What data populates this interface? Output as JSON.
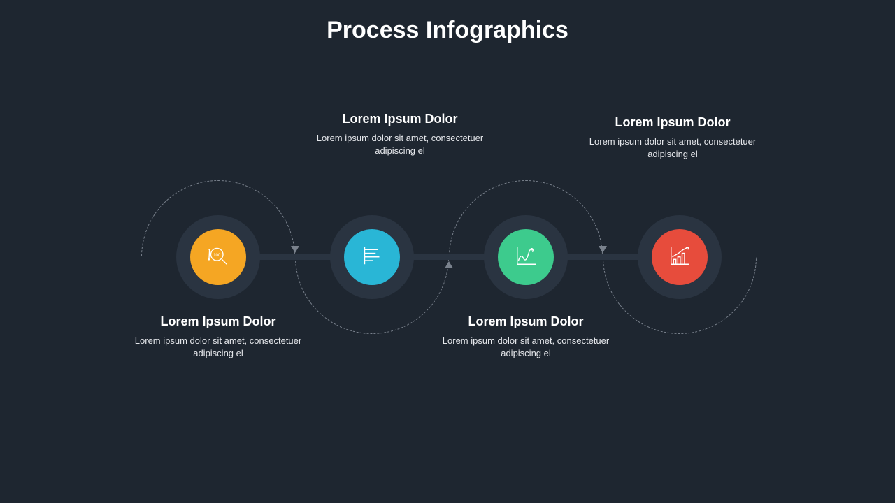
{
  "title": "Process Infographics",
  "steps": [
    {
      "heading": "Lorem Ipsum Dolor",
      "body": "Lorem ipsum dolor sit amet, consectetuer adipiscing el",
      "color": "#f5a623",
      "icon": "magnify-data"
    },
    {
      "heading": "Lorem Ipsum Dolor",
      "body": "Lorem ipsum dolor sit amet, consectetuer adipiscing el",
      "color": "#29b6d6",
      "icon": "bar-horizontal"
    },
    {
      "heading": "Lorem Ipsum Dolor",
      "body": "Lorem ipsum dolor sit amet, consectetuer adipiscing el",
      "color": "#3dcb8d",
      "icon": "line-chart"
    },
    {
      "heading": "Lorem Ipsum Dolor",
      "body": "Lorem ipsum dolor sit amet, consectetuer adipiscing el",
      "color": "#e74c3c",
      "icon": "bar-growth"
    }
  ]
}
